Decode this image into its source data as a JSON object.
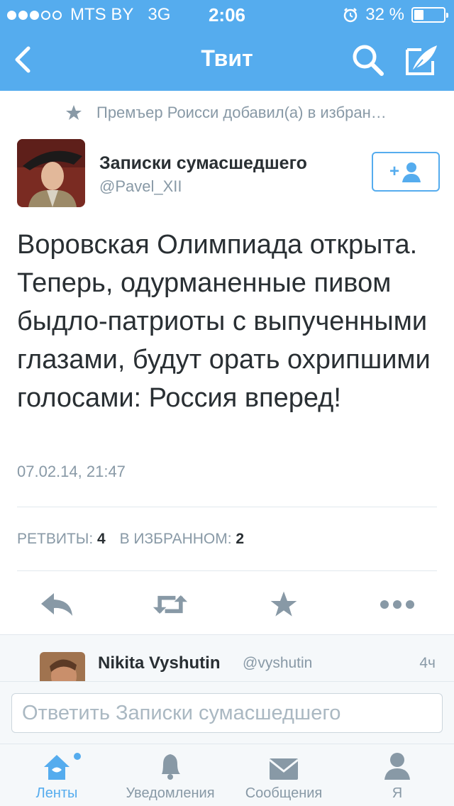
{
  "status_bar": {
    "carrier": "MTS BY",
    "network": "3G",
    "time": "2:06",
    "battery_text": "32 %",
    "battery_level": 0.32,
    "signal_bars": 3,
    "signal_total": 5
  },
  "nav": {
    "title": "Твит"
  },
  "tweet": {
    "favorited_by": "Премъер Роисси добавил(а) в избран…",
    "author_name": "Записки сумасшедшего",
    "author_handle": "@Pavel_XII",
    "follow_label": "+",
    "text": "Воровская Олимпиада открыта. Теперь, одурманенные пивом быдло-патриоты с выпученными глазами, будут орать охрипшими голосами: Россия вперед!",
    "timestamp": "07.02.14, 21:47",
    "retweets_label": "РЕТВИТЫ: ",
    "retweets_count": "4",
    "favorites_label": "В ИЗБРАННОМ: ",
    "favorites_count": "2"
  },
  "actions": [
    "reply-icon",
    "retweet-icon",
    "star-icon",
    "more-icon"
  ],
  "reply_preview": {
    "name": "Nikita Vyshutin",
    "handle": "@vyshutin",
    "ago": "4ч"
  },
  "compose": {
    "placeholder": "Ответить Записки сумасшедшего"
  },
  "tabs": [
    {
      "label": "Ленты",
      "icon": "home-icon",
      "active": true
    },
    {
      "label": "Уведомления",
      "icon": "bell-icon",
      "active": false
    },
    {
      "label": "Сообщения",
      "icon": "envelope-icon",
      "active": false
    },
    {
      "label": "Я",
      "icon": "person-icon",
      "active": false
    }
  ],
  "colors": {
    "brand": "#55acee",
    "text": "#292f33",
    "muted": "#8899a6",
    "icon": "#8899a6"
  }
}
